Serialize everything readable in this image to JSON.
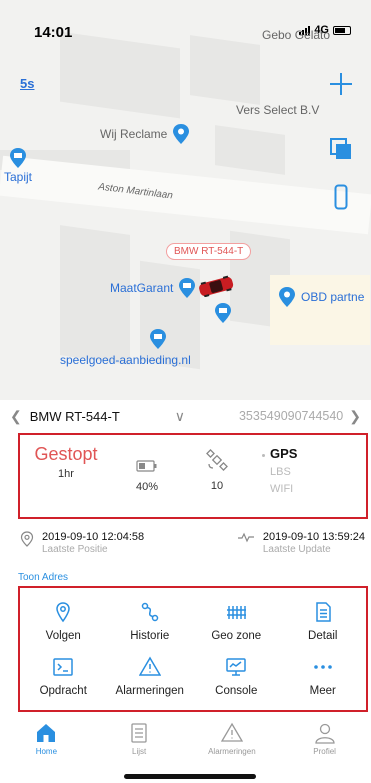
{
  "status_bar": {
    "time": "14:01",
    "network": "4G"
  },
  "map": {
    "refresh_interval": "5s",
    "road": "Aston Martinlaan",
    "pois": [
      {
        "name": "Gebo Gelato"
      },
      {
        "name": "Vers Select B.V"
      },
      {
        "name": "Wij Reclame"
      },
      {
        "name": "Tapijt"
      },
      {
        "name": "MaatGarant"
      },
      {
        "name": "OBD partne"
      },
      {
        "name": "speelgoed-aanbieding.nl"
      }
    ],
    "vehicle_tag": "BMW RT-544-T"
  },
  "vehicle": {
    "name": "BMW RT-544-T",
    "id": "353549090744540"
  },
  "status": {
    "state": "Gestopt",
    "duration": "1hr",
    "battery": "40%",
    "satellites": "10",
    "connections": {
      "active": "GPS",
      "inactive": [
        "LBS",
        "WIFI"
      ]
    }
  },
  "times": {
    "position_time": "2019-09-10 12:04:58",
    "position_label": "Laatste Positie",
    "update_time": "2019-09-10 13:59:24",
    "update_label": "Laatste Update"
  },
  "toon_adres": "Toon Adres",
  "actions": [
    {
      "label": "Volgen",
      "icon": "location-pin-icon"
    },
    {
      "label": "Historie",
      "icon": "route-icon"
    },
    {
      "label": "Geo zone",
      "icon": "fence-icon"
    },
    {
      "label": "Detail",
      "icon": "document-icon"
    },
    {
      "label": "Opdracht",
      "icon": "terminal-icon"
    },
    {
      "label": "Alarmeringen",
      "icon": "warning-icon"
    },
    {
      "label": "Console",
      "icon": "monitor-icon"
    },
    {
      "label": "Meer",
      "icon": "more-dots-icon"
    }
  ],
  "tabs": [
    {
      "label": "Home",
      "active": true
    },
    {
      "label": "Lijst",
      "active": false
    },
    {
      "label": "Alarmeringen",
      "active": false
    },
    {
      "label": "Profiel",
      "active": false
    }
  ],
  "colors": {
    "accent": "#2a8fe0",
    "alert": "#d0202a",
    "stopped": "#e05555"
  }
}
